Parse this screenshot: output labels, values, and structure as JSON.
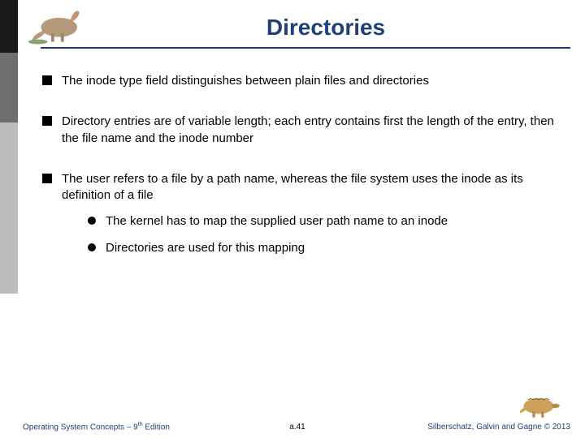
{
  "title": "Directories",
  "bullets": [
    {
      "text": "The inode type field distinguishes between plain files and directories"
    },
    {
      "text": "Directory entries are of variable length; each entry contains first the length of the entry, then the file name and the inode number"
    },
    {
      "text": "The user refers to a file by a path name, whereas the file system uses the inode as its definition of a file",
      "sub": [
        "The kernel has to map the supplied user path name to an inode",
        "Directories are used for this mapping"
      ]
    }
  ],
  "footer": {
    "left_prefix": "Operating System Concepts – 9",
    "left_suffix": " Edition",
    "left_sup": "th",
    "center": "a.41",
    "right": "Silberschatz, Galvin and Gagne © 2013"
  }
}
